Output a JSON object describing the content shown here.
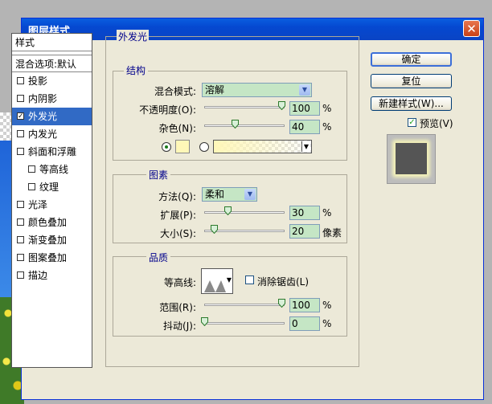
{
  "window": {
    "title": "图层样式",
    "close_glyph": "✕"
  },
  "styles_list": {
    "header": "样式",
    "blend_options": "混合选项:默认",
    "items": [
      {
        "label": "投影",
        "checked": false,
        "sub": false
      },
      {
        "label": "内阴影",
        "checked": false,
        "sub": false
      },
      {
        "label": "外发光",
        "checked": true,
        "sub": false,
        "selected": true
      },
      {
        "label": "内发光",
        "checked": false,
        "sub": false
      },
      {
        "label": "斜面和浮雕",
        "checked": false,
        "sub": false
      },
      {
        "label": "等高线",
        "checked": false,
        "sub": true
      },
      {
        "label": "纹理",
        "checked": false,
        "sub": true
      },
      {
        "label": "光泽",
        "checked": false,
        "sub": false
      },
      {
        "label": "颜色叠加",
        "checked": false,
        "sub": false
      },
      {
        "label": "渐变叠加",
        "checked": false,
        "sub": false
      },
      {
        "label": "图案叠加",
        "checked": false,
        "sub": false
      },
      {
        "label": "描边",
        "checked": false,
        "sub": false
      }
    ],
    "check_glyph": "✓"
  },
  "outer_glow": {
    "title": "外发光",
    "structure": {
      "title": "结构",
      "blend_mode_label": "混合模式:",
      "blend_mode_value": "溶解",
      "opacity_label": "不透明度(O):",
      "opacity_value": "100",
      "opacity_percent": 100,
      "noise_label": "杂色(N):",
      "noise_value": "40",
      "noise_percent": 40,
      "unit_percent": "%",
      "glow_color": "#fff7b8"
    },
    "elements": {
      "title": "图素",
      "technique_label": "方法(Q):",
      "technique_value": "柔和",
      "spread_label": "扩展(P):",
      "spread_value": "30",
      "spread_percent": 30,
      "size_label": "大小(S):",
      "size_value": "20",
      "size_unit": "像素",
      "unit_percent": "%"
    },
    "quality": {
      "title": "品质",
      "contour_label": "等高线:",
      "anti_alias_label": "消除锯齿(L)",
      "range_label": "范围(R):",
      "range_value": "100",
      "range_percent": 100,
      "jitter_label": "抖动(J):",
      "jitter_value": "0",
      "jitter_percent": 0,
      "unit_percent": "%"
    }
  },
  "buttons": {
    "ok": "确定",
    "reset": "复位",
    "new_style": "新建样式(W)...",
    "preview_label": "预览(V)",
    "preview_checked": true
  },
  "colors": {
    "title_bar": "#0a5ee0",
    "selection": "#316ac5",
    "field_bg": "#c5e6c5"
  }
}
